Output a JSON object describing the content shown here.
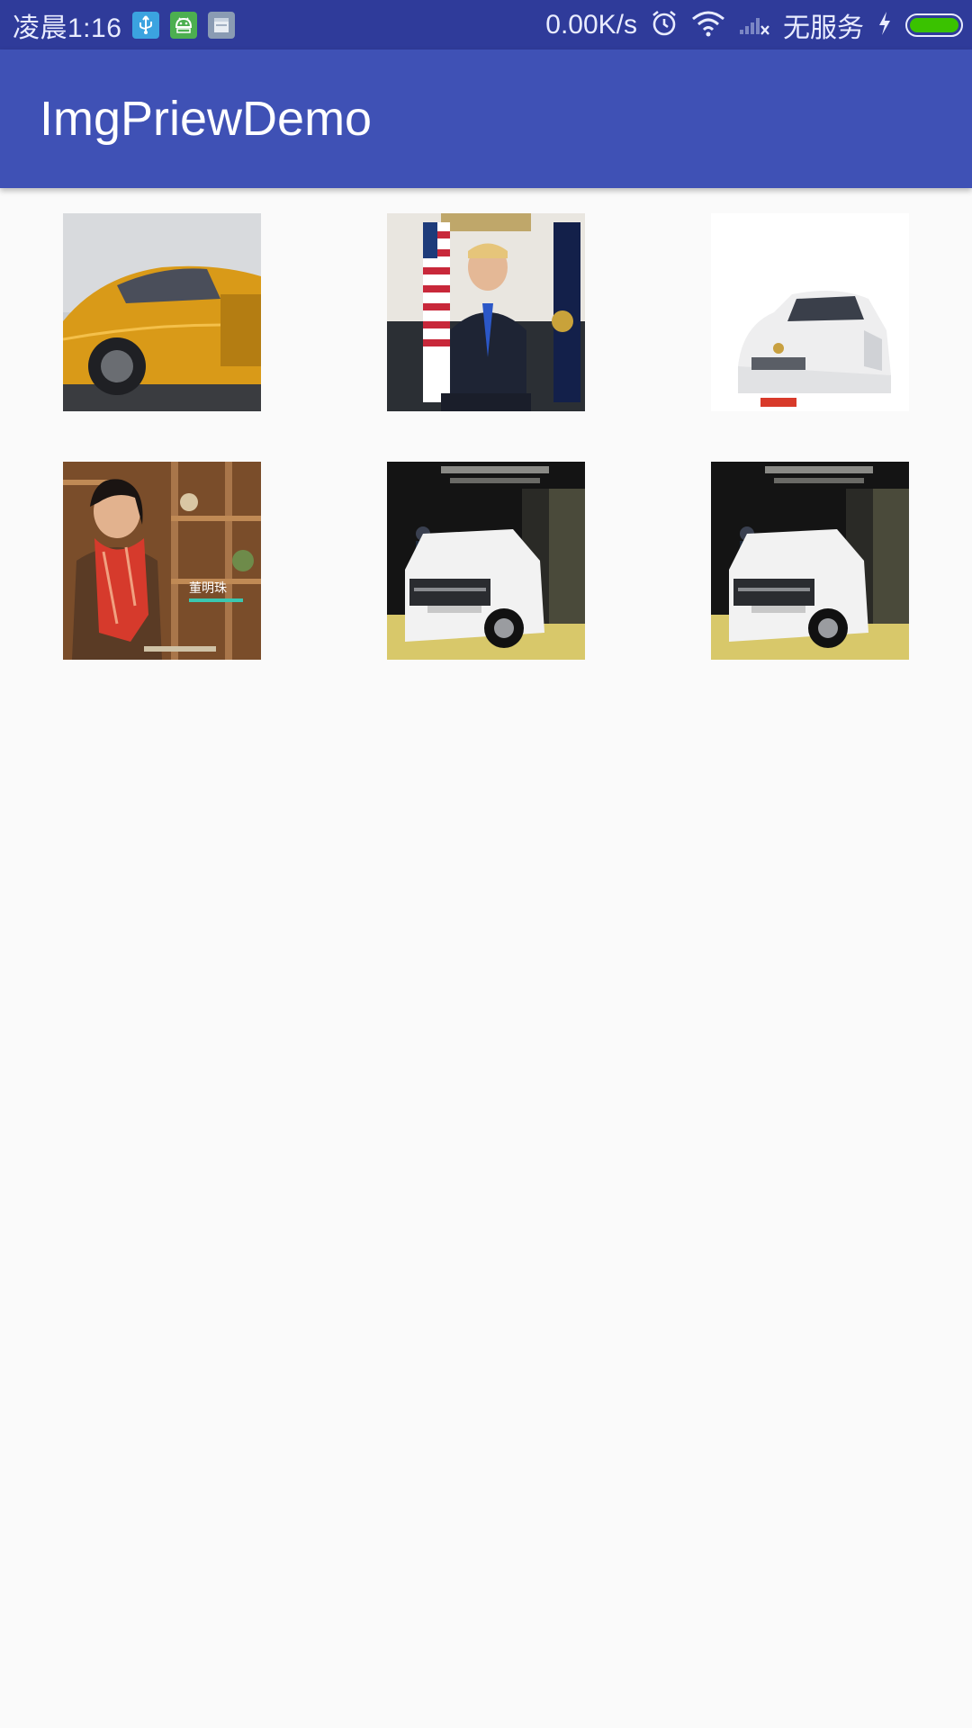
{
  "status_bar": {
    "time": "凌晨1:16",
    "network_speed": "0.00K/s",
    "carrier": "无服务",
    "icons": [
      "usb-icon",
      "android-icon",
      "notes-icon",
      "alarm-icon",
      "wifi-icon",
      "signal-icon",
      "charging-icon",
      "battery-icon"
    ],
    "battery_level": 1.0,
    "colors": {
      "bar": "#2f3b9a",
      "battery": "#3ac200"
    }
  },
  "app_bar": {
    "title": "ImgPriewDemo",
    "color": "#3f51b5"
  },
  "gallery": {
    "images": [
      {
        "subject": "orange-sports-car"
      },
      {
        "subject": "man-at-podium-with-flags"
      },
      {
        "subject": "white-sedan"
      },
      {
        "subject": "woman-in-red-scarf",
        "caption": "董明珠"
      },
      {
        "subject": "white-suv-showroom"
      },
      {
        "subject": "white-suv-showroom"
      }
    ]
  }
}
